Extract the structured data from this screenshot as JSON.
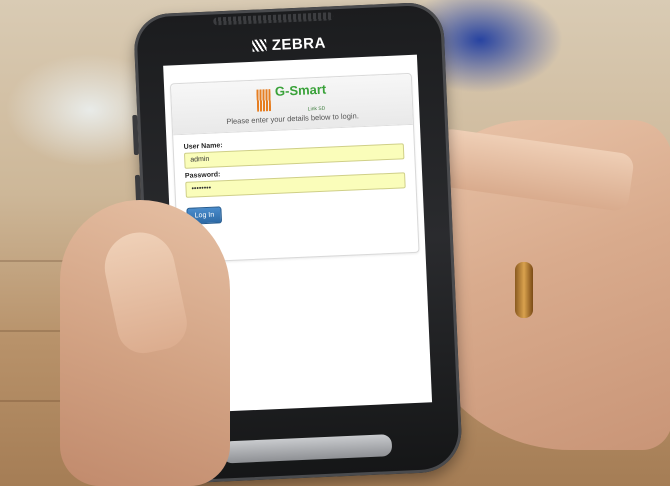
{
  "device": {
    "brand": "ZEBRA"
  },
  "login_page": {
    "logo": {
      "name": "G-Smart",
      "sub": "Link SD"
    },
    "instructions": "Please enter your details below to login.",
    "username": {
      "label": "User Name:",
      "value": "admin"
    },
    "password": {
      "label": "Password:",
      "value": "••••••••"
    },
    "submit_label": "Log In"
  },
  "colors": {
    "field_background": "#fafdba",
    "button_blue": "#2d6aa6",
    "logo_green": "#3aa23a",
    "logo_orange": "#e67e22"
  }
}
